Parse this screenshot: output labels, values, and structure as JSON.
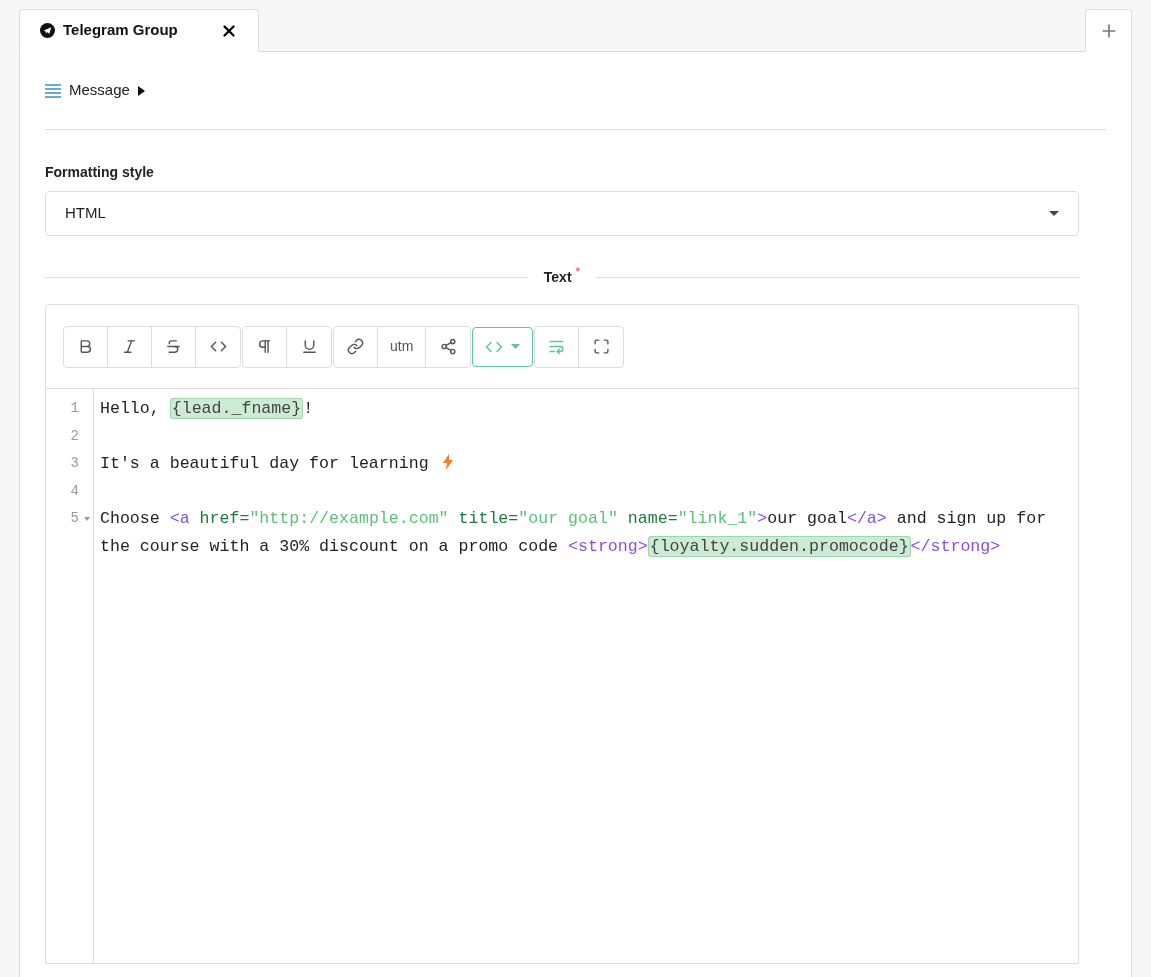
{
  "tabs": [
    {
      "label": "Telegram Group",
      "selected": true
    }
  ],
  "section": {
    "title": "Message",
    "expanded": false
  },
  "formatting": {
    "label": "Formatting style",
    "value": "HTML"
  },
  "text_field": {
    "label": "Text",
    "required_mark": "*"
  },
  "toolbar": [
    [
      {
        "kind": "bold"
      },
      {
        "kind": "italic"
      },
      {
        "kind": "strike"
      },
      {
        "kind": "code"
      }
    ],
    [
      {
        "kind": "paragraph"
      },
      {
        "kind": "underline"
      }
    ],
    [
      {
        "kind": "link"
      },
      {
        "kind": "text",
        "label": "utm"
      },
      {
        "kind": "share"
      }
    ],
    [
      {
        "kind": "source",
        "active": true
      }
    ],
    [
      {
        "kind": "wrap",
        "active": true
      },
      {
        "kind": "fullscreen"
      }
    ]
  ],
  "editor": {
    "lines": [
      {
        "number": "1",
        "tokens": [
          {
            "kind": "plain",
            "text": "Hello, "
          },
          {
            "kind": "var",
            "text": "{lead._fname}"
          },
          {
            "kind": "plain",
            "text": "!"
          }
        ]
      },
      {
        "number": "2"
      },
      {
        "number": "3",
        "bolt": true,
        "tokens": [
          {
            "kind": "plain",
            "text": "It's a beautiful day for learning "
          }
        ]
      },
      {
        "number": "4"
      },
      {
        "number": "5",
        "foldable": true,
        "tokens": [
          {
            "kind": "plain",
            "text": "Choose "
          },
          {
            "kind": "tag",
            "text": "<a"
          },
          {
            "kind": "attr",
            "text": " href="
          },
          {
            "kind": "string",
            "text": "\"http://example.com\""
          },
          {
            "kind": "attr",
            "text": " title="
          },
          {
            "kind": "string",
            "text": "\"our goal\""
          },
          {
            "kind": "attr",
            "text": " name="
          },
          {
            "kind": "string",
            "text": "\"link_1\""
          },
          {
            "kind": "tag",
            "text": ">"
          },
          {
            "kind": "plain",
            "text": "our goal"
          },
          {
            "kind": "tag",
            "text": "</a>"
          },
          {
            "kind": "plain",
            "text": " and sign up for the course with a 30% discount on a promo code "
          },
          {
            "kind": "tag",
            "text": "<strong>"
          },
          {
            "kind": "var",
            "text": "{loyalty.sudden.promocode}"
          },
          {
            "kind": "tag",
            "text": "</strong>"
          }
        ]
      }
    ]
  }
}
